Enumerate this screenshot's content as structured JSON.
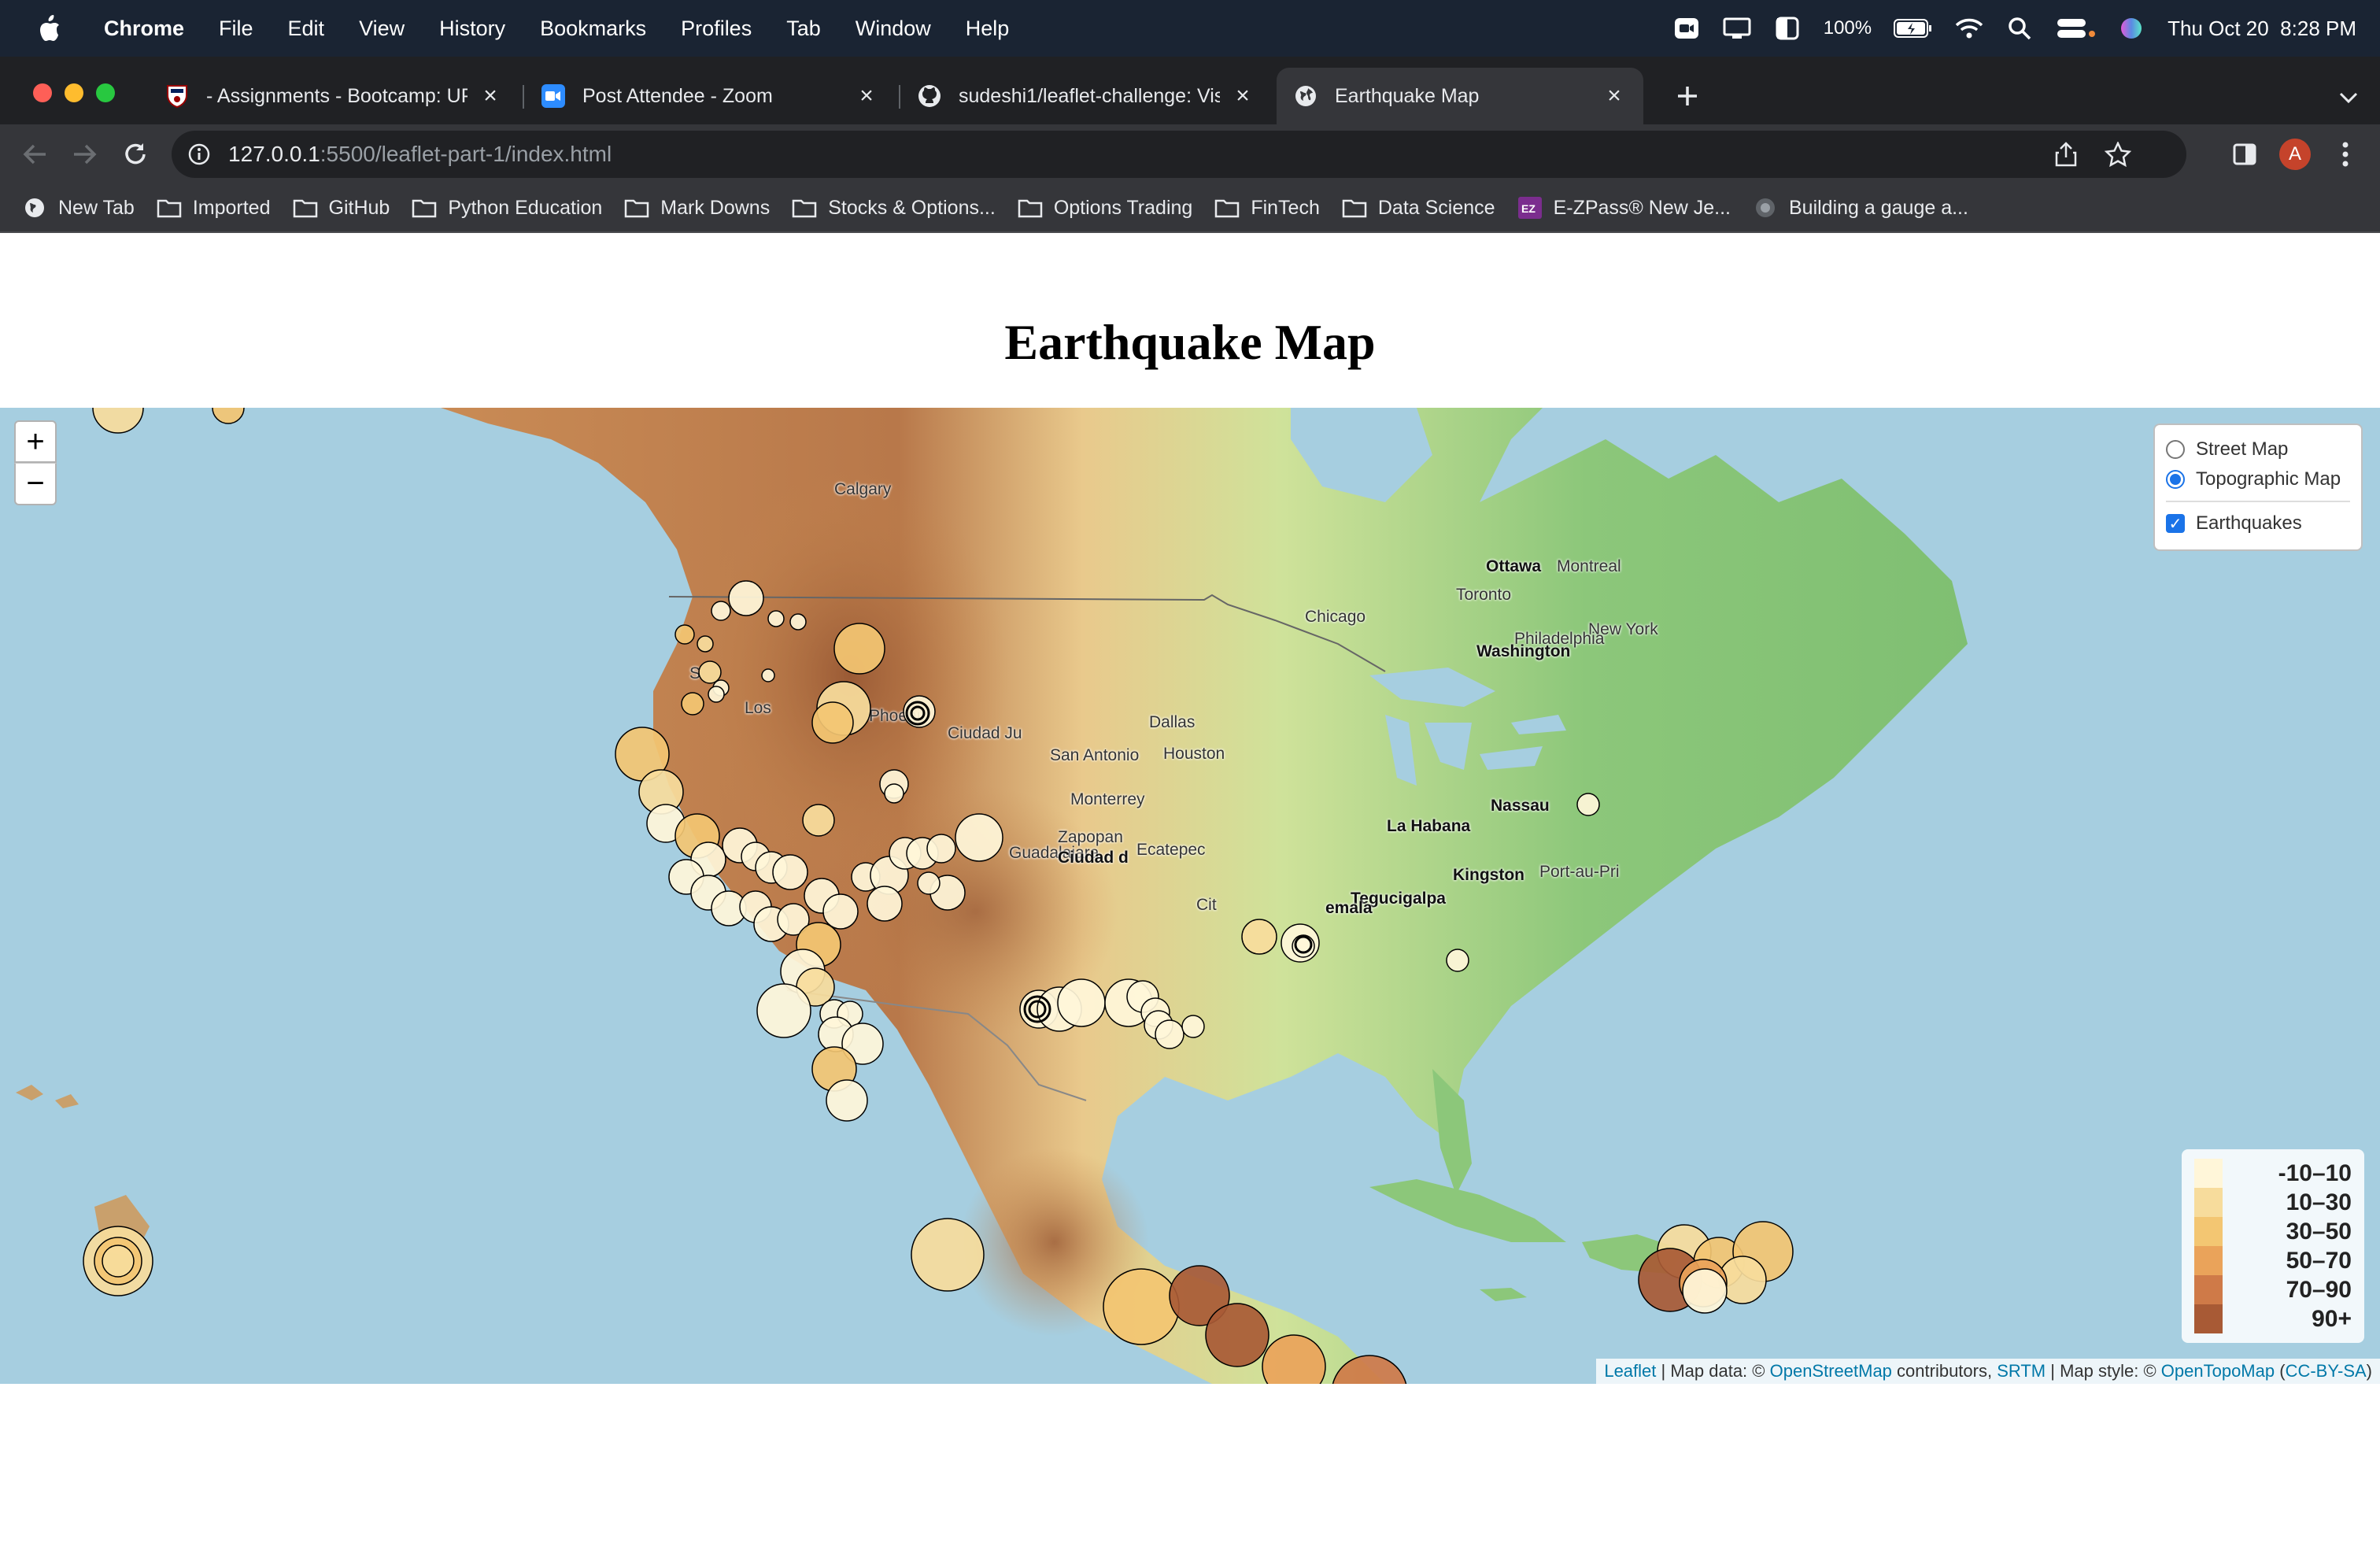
{
  "menubar": {
    "app": "Chrome",
    "items": [
      "File",
      "Edit",
      "View",
      "History",
      "Bookmarks",
      "Profiles",
      "Tab",
      "Window",
      "Help"
    ],
    "battery": "100%",
    "datetime": "Thu Oct 20  8:28 PM"
  },
  "tabs": [
    {
      "title": "- Assignments - Bootcamp: UP",
      "icon": "penn-shield-icon",
      "active": false
    },
    {
      "title": "Post Attendee - Zoom",
      "icon": "zoom-icon",
      "active": false
    },
    {
      "title": "sudeshi1/leaflet-challenge: Visu",
      "icon": "github-icon",
      "active": false
    },
    {
      "title": "Earthquake Map",
      "icon": "globe-icon",
      "active": true
    }
  ],
  "omnibox": {
    "host": "127.0.0.1",
    "path": ":5500/leaflet-part-1/index.html"
  },
  "profile_initial": "A",
  "bookmarks": [
    {
      "label": "New Tab",
      "icon": "globe-icon"
    },
    {
      "label": "Imported",
      "icon": "folder-icon"
    },
    {
      "label": "GitHub",
      "icon": "folder-icon"
    },
    {
      "label": "Python Education",
      "icon": "folder-icon"
    },
    {
      "label": "Mark Downs",
      "icon": "folder-icon"
    },
    {
      "label": "Stocks & Options...",
      "icon": "folder-icon"
    },
    {
      "label": "Options Trading",
      "icon": "folder-icon"
    },
    {
      "label": "FinTech",
      "icon": "folder-icon"
    },
    {
      "label": "Data Science",
      "icon": "folder-icon"
    },
    {
      "label": "E-ZPass® New Je...",
      "icon": "ezpass-icon"
    },
    {
      "label": "Building a gauge a...",
      "icon": "gauge-icon"
    }
  ],
  "page": {
    "title": "Earthquake Map"
  },
  "map": {
    "zoom_in": "+",
    "zoom_out": "−",
    "layers": {
      "base": [
        {
          "label": "Street Map",
          "checked": false
        },
        {
          "label": "Topographic Map",
          "checked": true
        }
      ],
      "overlays": [
        {
          "label": "Earthquakes",
          "checked": true
        }
      ]
    },
    "legend": [
      {
        "label": "-10–10",
        "color": "#fff6d9"
      },
      {
        "label": "10–30",
        "color": "#f7dc9c"
      },
      {
        "label": "30–50",
        "color": "#f3c672"
      },
      {
        "label": "50–70",
        "color": "#eaa35a"
      },
      {
        "label": "70–90",
        "color": "#cf7a48"
      },
      {
        "label": "90+",
        "color": "#a85a35"
      }
    ],
    "cities": [
      {
        "name": "Calgary",
        "major": false
      },
      {
        "name": "Ottawa",
        "major": true
      },
      {
        "name": "Montreal",
        "major": false
      },
      {
        "name": "Toronto",
        "major": false
      },
      {
        "name": "Chicago",
        "major": false
      },
      {
        "name": "New York",
        "major": false
      },
      {
        "name": "Philadelphia",
        "major": false
      },
      {
        "name": "Washington",
        "major": true
      },
      {
        "name": "Phoenix",
        "major": false
      },
      {
        "name": "Dallas",
        "major": false
      },
      {
        "name": "Ciudad Ju",
        "major": false
      },
      {
        "name": "San Antonio",
        "major": false
      },
      {
        "name": "Houston",
        "major": false
      },
      {
        "name": "Monterrey",
        "major": false
      },
      {
        "name": "Nassau",
        "major": true
      },
      {
        "name": "La Habana",
        "major": true
      },
      {
        "name": "Zapopan",
        "major": false
      },
      {
        "name": "Guadalajara",
        "major": false
      },
      {
        "name": "Ciudad d",
        "major": true
      },
      {
        "name": "Ecatepec",
        "major": false
      },
      {
        "name": "Kingston",
        "major": true
      },
      {
        "name": "Port-au-Pri",
        "major": false
      },
      {
        "name": "Tegucigalpa",
        "major": true
      },
      {
        "name": "Los",
        "major": false
      },
      {
        "name": "S",
        "major": false
      },
      {
        "name": "Cit",
        "major": false
      },
      {
        "name": "emala",
        "major": true
      }
    ],
    "attribution": {
      "leaflet": "Leaflet",
      "sep1": " | Map data: © ",
      "osm": "OpenStreetMap",
      "contrib": " contributors, ",
      "srtm": "SRTM",
      "sep2": " | Map style: © ",
      "otm": "OpenTopoMap",
      "paren_open": " (",
      "cc": "CC-BY-SA",
      "paren_close": ")"
    }
  }
}
